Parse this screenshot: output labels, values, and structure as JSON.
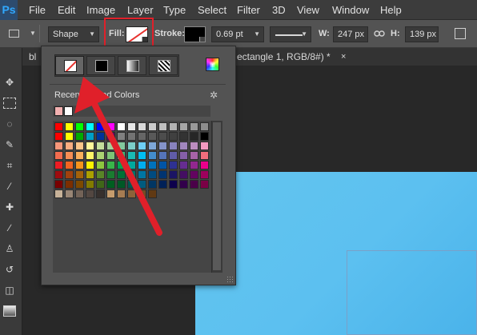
{
  "menubar": {
    "logo": "Ps",
    "items": [
      "File",
      "Edit",
      "Image",
      "Layer",
      "Type",
      "Select",
      "Filter",
      "3D",
      "View",
      "Window",
      "Help"
    ]
  },
  "options": {
    "mode_value": "Shape",
    "fill_label": "Fill:",
    "stroke_label": "Stroke:",
    "stroke_width": "0.69 pt",
    "w_label": "W:",
    "w_value": "247 px",
    "h_label": "H:",
    "h_value": "139 px"
  },
  "document_tabs": [
    {
      "label": "bl"
    },
    {
      "label": "ectangle 1, RGB/8#) *"
    }
  ],
  "tabs_close_glyph": "×",
  "fill_popup": {
    "fill_types": [
      "no-color",
      "solid-color",
      "gradient",
      "pattern"
    ],
    "active_type": "no-color",
    "recent_title": "Recently Used Colors",
    "recent_colors": [
      "#f2b1b1",
      "#ffffff"
    ],
    "swatch_rows": [
      [
        "#ff0000",
        "#ffff00",
        "#00ff00",
        "#00ffff",
        "#0000ff",
        "#ff00ff",
        "#ffffff",
        "#e6e6e6",
        "#d9d9d9",
        "#cccccc",
        "#bfbfbf",
        "#b3b3b3",
        "#a6a6a6",
        "#999999",
        "#8c8c8c"
      ],
      [
        "#ff0000",
        "#ffff00",
        "#00aa00",
        "#00a0c6",
        "#003399",
        "#660066",
        "#808080",
        "#737373",
        "#666666",
        "#595959",
        "#4d4d4d",
        "#404040",
        "#333333",
        "#262626",
        "#000000"
      ],
      [
        "#f7977a",
        "#f9ad81",
        "#fdc68a",
        "#fff79a",
        "#c4df9b",
        "#a3d39c",
        "#82ca9d",
        "#7bcdc8",
        "#6ecff6",
        "#7ea7d8",
        "#8493ca",
        "#8882be",
        "#a187be",
        "#bc8dbf",
        "#f49ac2"
      ],
      [
        "#f26c4f",
        "#f68e55",
        "#fbaf5c",
        "#fff467",
        "#acd372",
        "#7cc576",
        "#3bb878",
        "#1abbb4",
        "#00bff3",
        "#438ccb",
        "#5574b9",
        "#605ca8",
        "#855fa8",
        "#a763a8",
        "#f26d7d"
      ],
      [
        "#ed1c24",
        "#f26522",
        "#f7941d",
        "#fff200",
        "#8dc73f",
        "#39b54a",
        "#00a651",
        "#00a99d",
        "#00aeef",
        "#0072bc",
        "#0054a6",
        "#2e3192",
        "#662d91",
        "#92278f",
        "#ec008c"
      ],
      [
        "#9e0b0f",
        "#a0410d",
        "#a3620a",
        "#aba000",
        "#598527",
        "#1a7b30",
        "#007236",
        "#00746b",
        "#0076a3",
        "#004b80",
        "#003471",
        "#1b1464",
        "#440e62",
        "#630460",
        "#9e005d"
      ],
      [
        "#790000",
        "#7b2e00",
        "#7d4900",
        "#827b00",
        "#406618",
        "#005e20",
        "#005826",
        "#005952",
        "#005b7f",
        "#003663",
        "#002157",
        "#0d004c",
        "#32004b",
        "#4b0049",
        "#7b0046"
      ],
      [
        "#c7b299",
        "#998675",
        "#736357",
        "#534741",
        "#37302d",
        "#c69c6d",
        "#a67c52",
        "#8c6239",
        "#754c24",
        "#603913"
      ]
    ]
  },
  "colors": {
    "annotation_red": "#e0202a",
    "canvas_blue": "#5cc0f0"
  }
}
